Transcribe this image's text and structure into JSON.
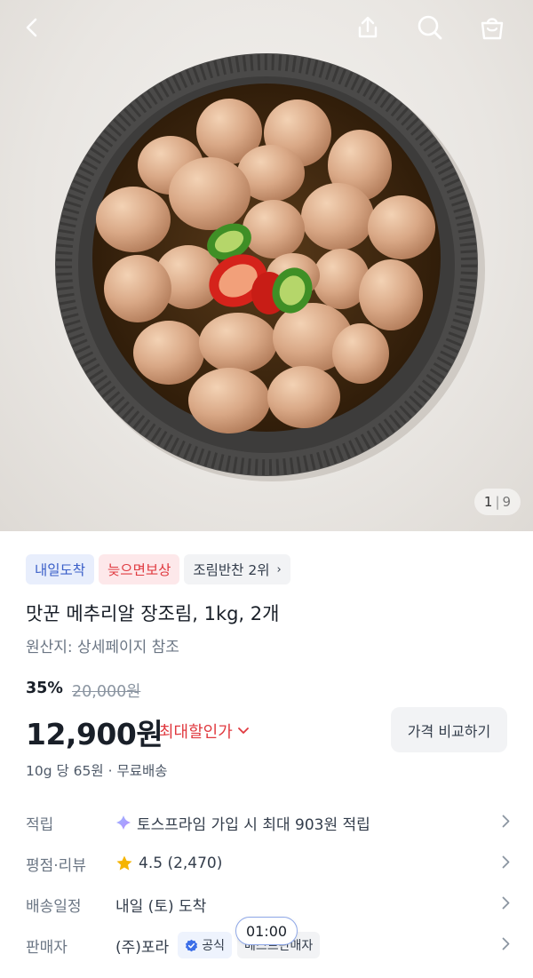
{
  "header": {
    "back_icon": "chevron-left-icon",
    "share_icon": "share-icon",
    "search_icon": "search-icon",
    "cart_icon": "shopping-bag-icon"
  },
  "gallery": {
    "current": "1",
    "total": "9"
  },
  "badges": [
    {
      "label": "내일도착",
      "color": "#3a5fc8"
    },
    {
      "label": "늦으면보상",
      "color": "#e0393f"
    },
    {
      "label": "조림반찬 2위"
    }
  ],
  "product": {
    "title": "맛꾼 메추리알 장조림, 1kg, 2개",
    "origin": "원산지: 상세페이지 참조",
    "discount": "35%",
    "original_price": "20,000원",
    "price": "12,900원",
    "max_discount_label": "최대할인가",
    "compare_button": "가격 비교하기",
    "unit_price": "10g 당 65원 · 무료배송"
  },
  "info_rows": {
    "points": {
      "label": "적립",
      "value": "토스프라임 가입 시 최대 903원 적립"
    },
    "rating": {
      "label": "평점·리뷰",
      "value": "4.5 (2,470)"
    },
    "delivery": {
      "label": "배송일정",
      "value": "내일 (토) 도착"
    },
    "seller": {
      "label": "판매자",
      "value": "(주)포라",
      "tag_official": "공식",
      "tag_best": "베스트판매자"
    }
  },
  "overlay": {
    "time": "01:00"
  },
  "colors": {
    "accent_red": "#e0393f",
    "accent_blue": "#3a5fc8",
    "star": "#f5b400"
  }
}
